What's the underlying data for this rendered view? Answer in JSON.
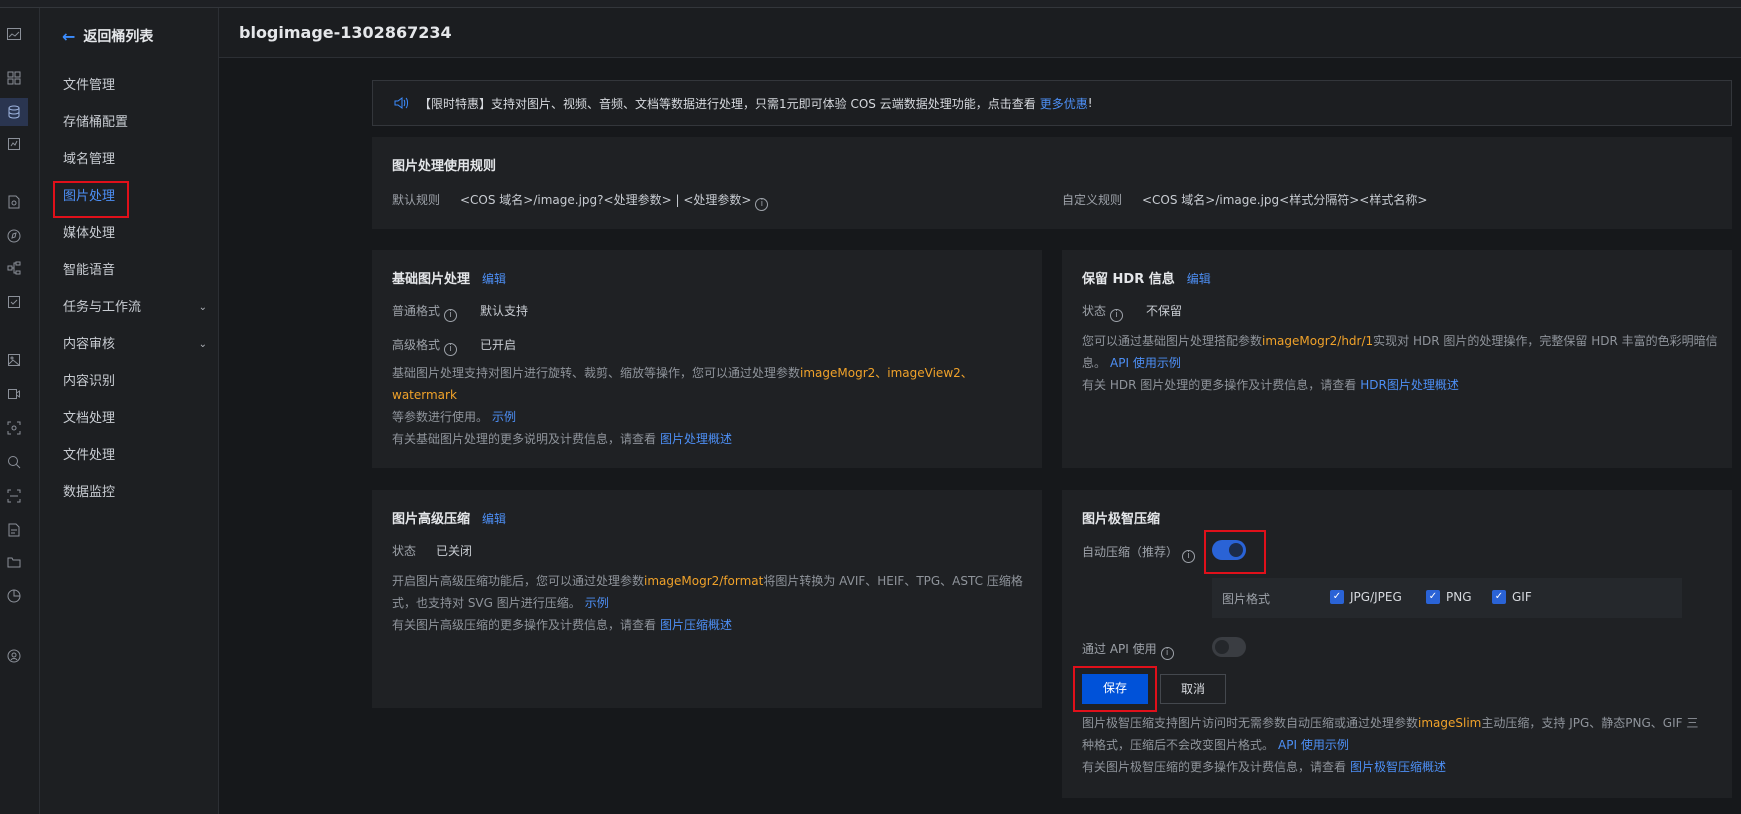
{
  "header": {
    "title": "blogimage-1302867234"
  },
  "sidebar": {
    "back_label": "返回桶列表",
    "items": [
      {
        "label": "文件管理",
        "chev": ""
      },
      {
        "label": "存储桶配置",
        "chev": ""
      },
      {
        "label": "域名管理",
        "chev": ""
      },
      {
        "label": "图片处理",
        "chev": ""
      },
      {
        "label": "媒体处理",
        "chev": ""
      },
      {
        "label": "智能语音",
        "chev": ""
      },
      {
        "label": "任务与工作流",
        "chev": "⌄"
      },
      {
        "label": "内容审核",
        "chev": "⌄"
      },
      {
        "label": "内容识别",
        "chev": ""
      },
      {
        "label": "文档处理",
        "chev": ""
      },
      {
        "label": "文件处理",
        "chev": ""
      },
      {
        "label": "数据监控",
        "chev": ""
      }
    ]
  },
  "banner": {
    "text": "【限时特惠】支持对图片、视频、音频、文档等数据进行处理，只需1元即可体验 COS 云端数据处理功能，点击查看",
    "link": "更多优惠",
    "tail": "!"
  },
  "rules": {
    "title": "图片处理使用规则",
    "default_label": "默认规则",
    "default_value": "<COS 域名>/image.jpg?<处理参数> | <处理参数>",
    "custom_label": "自定义规则",
    "custom_value": "<COS 域名>/image.jpg<样式分隔符><样式名称>"
  },
  "basic": {
    "title": "基础图片处理",
    "edit": "编辑",
    "normal_label": "普通格式",
    "normal_value": "默认支持",
    "adv_label": "高级格式",
    "adv_value": "已开启",
    "desc1": "基础图片处理支持对图片进行旋转、裁剪、缩放等操作，您可以通过处理参数",
    "params": "imageMogr2、imageView2、watermark",
    "desc2": "等参数进行使用。",
    "example": "示例",
    "more": "有关基础图片处理的更多说明及计费信息，请查看",
    "more_link": "图片处理概述"
  },
  "hdr": {
    "title": "保留 HDR 信息",
    "edit": "编辑",
    "status_label": "状态",
    "status_value": "不保留",
    "desc1": "您可以通过基础图片处理搭配参数",
    "param": "imageMogr2/hdr/1",
    "desc2": "实现对 HDR 图片的处理操作，完整保留 HDR 丰富的色彩明暗信",
    "desc3": "息。",
    "api_link": "API 使用示例",
    "more": "有关 HDR 图片处理的更多操作及计费信息，请查看",
    "more_link": "HDR图片处理概述"
  },
  "advcompress": {
    "title": "图片高级压缩",
    "edit": "编辑",
    "status_label": "状态",
    "status_value": "已关闭",
    "desc1": "开启图片高级压缩功能后，您可以通过处理参数",
    "param": "imageMogr2/format",
    "desc2": "将图片转换为 AVIF、HEIF、TPG、ASTC 压缩格",
    "desc3": "式，也支持对 SVG 图片进行压缩。",
    "example": "示例",
    "more": "有关图片高级压缩的更多操作及计费信息，请查看",
    "more_link": "图片压缩概述"
  },
  "slim": {
    "title": "图片极智压缩",
    "auto_label": "自动压缩（推荐）",
    "auto_on": true,
    "format_label": "图片格式",
    "formats": [
      "JPG/JPEG",
      "PNG",
      "GIF"
    ],
    "api_label": "通过 API 使用",
    "api_on": false,
    "save": "保存",
    "cancel": "取消",
    "desc1": "图片极智压缩支持图片访问时无需参数自动压缩或通过处理参数",
    "param": "imageSlim",
    "desc2": "主动压缩，支持 JPG、静态PNG、GIF 三",
    "desc3": "种格式，压缩后不会改变图片格式。",
    "api_link": "API 使用示例",
    "more": "有关图片极智压缩的更多操作及计费信息，请查看",
    "more_link": "图片极智压缩概述"
  },
  "info_icon_glyph": "i",
  "colors": {
    "accent": "#0052d9",
    "link": "#4d8ff5",
    "highlight": "#f0a22a",
    "annotation": "#e0101a"
  }
}
